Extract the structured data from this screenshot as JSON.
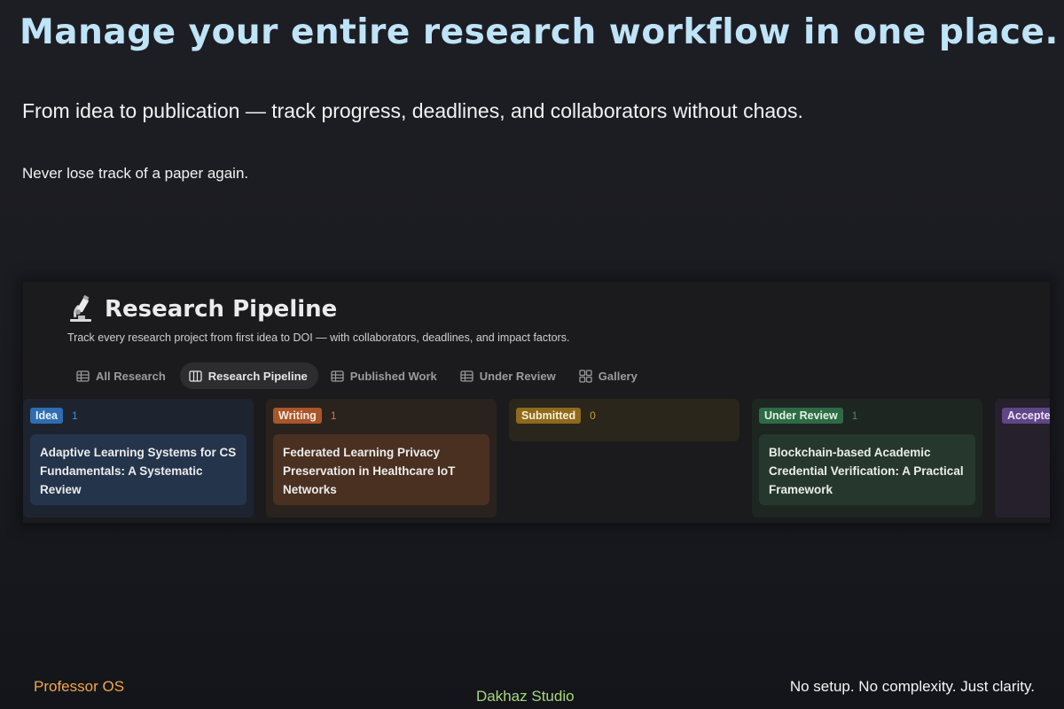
{
  "hero": {
    "headline": "Manage your entire research workflow in one place.",
    "subhead": "From idea to publication — track progress, deadlines, and collaborators without chaos.",
    "tagline": "Never lose track of a paper again."
  },
  "app": {
    "title_icon": "microscope-icon",
    "title": "Research Pipeline",
    "description": "Track every research project from first idea to DOI — with collaborators, deadlines, and impact factors.",
    "tabs": [
      {
        "label": "All Research",
        "icon": "table-icon",
        "active": false
      },
      {
        "label": "Research Pipeline",
        "icon": "board-icon",
        "active": true
      },
      {
        "label": "Published Work",
        "icon": "table-icon",
        "active": false
      },
      {
        "label": "Under Review",
        "icon": "table-icon",
        "active": false
      },
      {
        "label": "Gallery",
        "icon": "gallery-icon",
        "active": false
      }
    ],
    "columns": [
      {
        "label": "Idea",
        "count": "1",
        "color": "#2f6db0",
        "text_color": "#e7f0fb",
        "count_color": "#4a8ad4",
        "cards": [
          {
            "title": "Adaptive Learning Systems for CS Fundamentals: A Systematic Review",
            "bg": "#24344b"
          }
        ]
      },
      {
        "label": "Writing",
        "count": "1",
        "color": "#a8562a",
        "text_color": "#fbe9dc",
        "count_color": "#d0793f",
        "cards": [
          {
            "title": "Federated Learning Privacy Preservation in Healthcare IoT Networks",
            "bg": "#4a3021"
          }
        ]
      },
      {
        "label": "Submitted",
        "count": "0",
        "color": "#8e6a1d",
        "text_color": "#fbeed0",
        "count_color": "#c79a34",
        "cards": []
      },
      {
        "label": "Under Review",
        "count": "1",
        "color": "#2e6b45",
        "text_color": "#ddf3e4",
        "count_color": "#4d8a62",
        "cards": [
          {
            "title": "Blockchain-based Academic Credential Verification: A Practical Framework",
            "bg": "#26382d"
          }
        ]
      },
      {
        "label": "Accepted",
        "count": "",
        "color": "#5f4687",
        "text_color": "#ece2fa",
        "count_color": "#8c6bbd",
        "cards": []
      }
    ]
  },
  "footer": {
    "brand_left": "Professor OS",
    "brand_center": "Dakhaz Studio",
    "slogan": "No setup. No complexity. Just clarity."
  }
}
